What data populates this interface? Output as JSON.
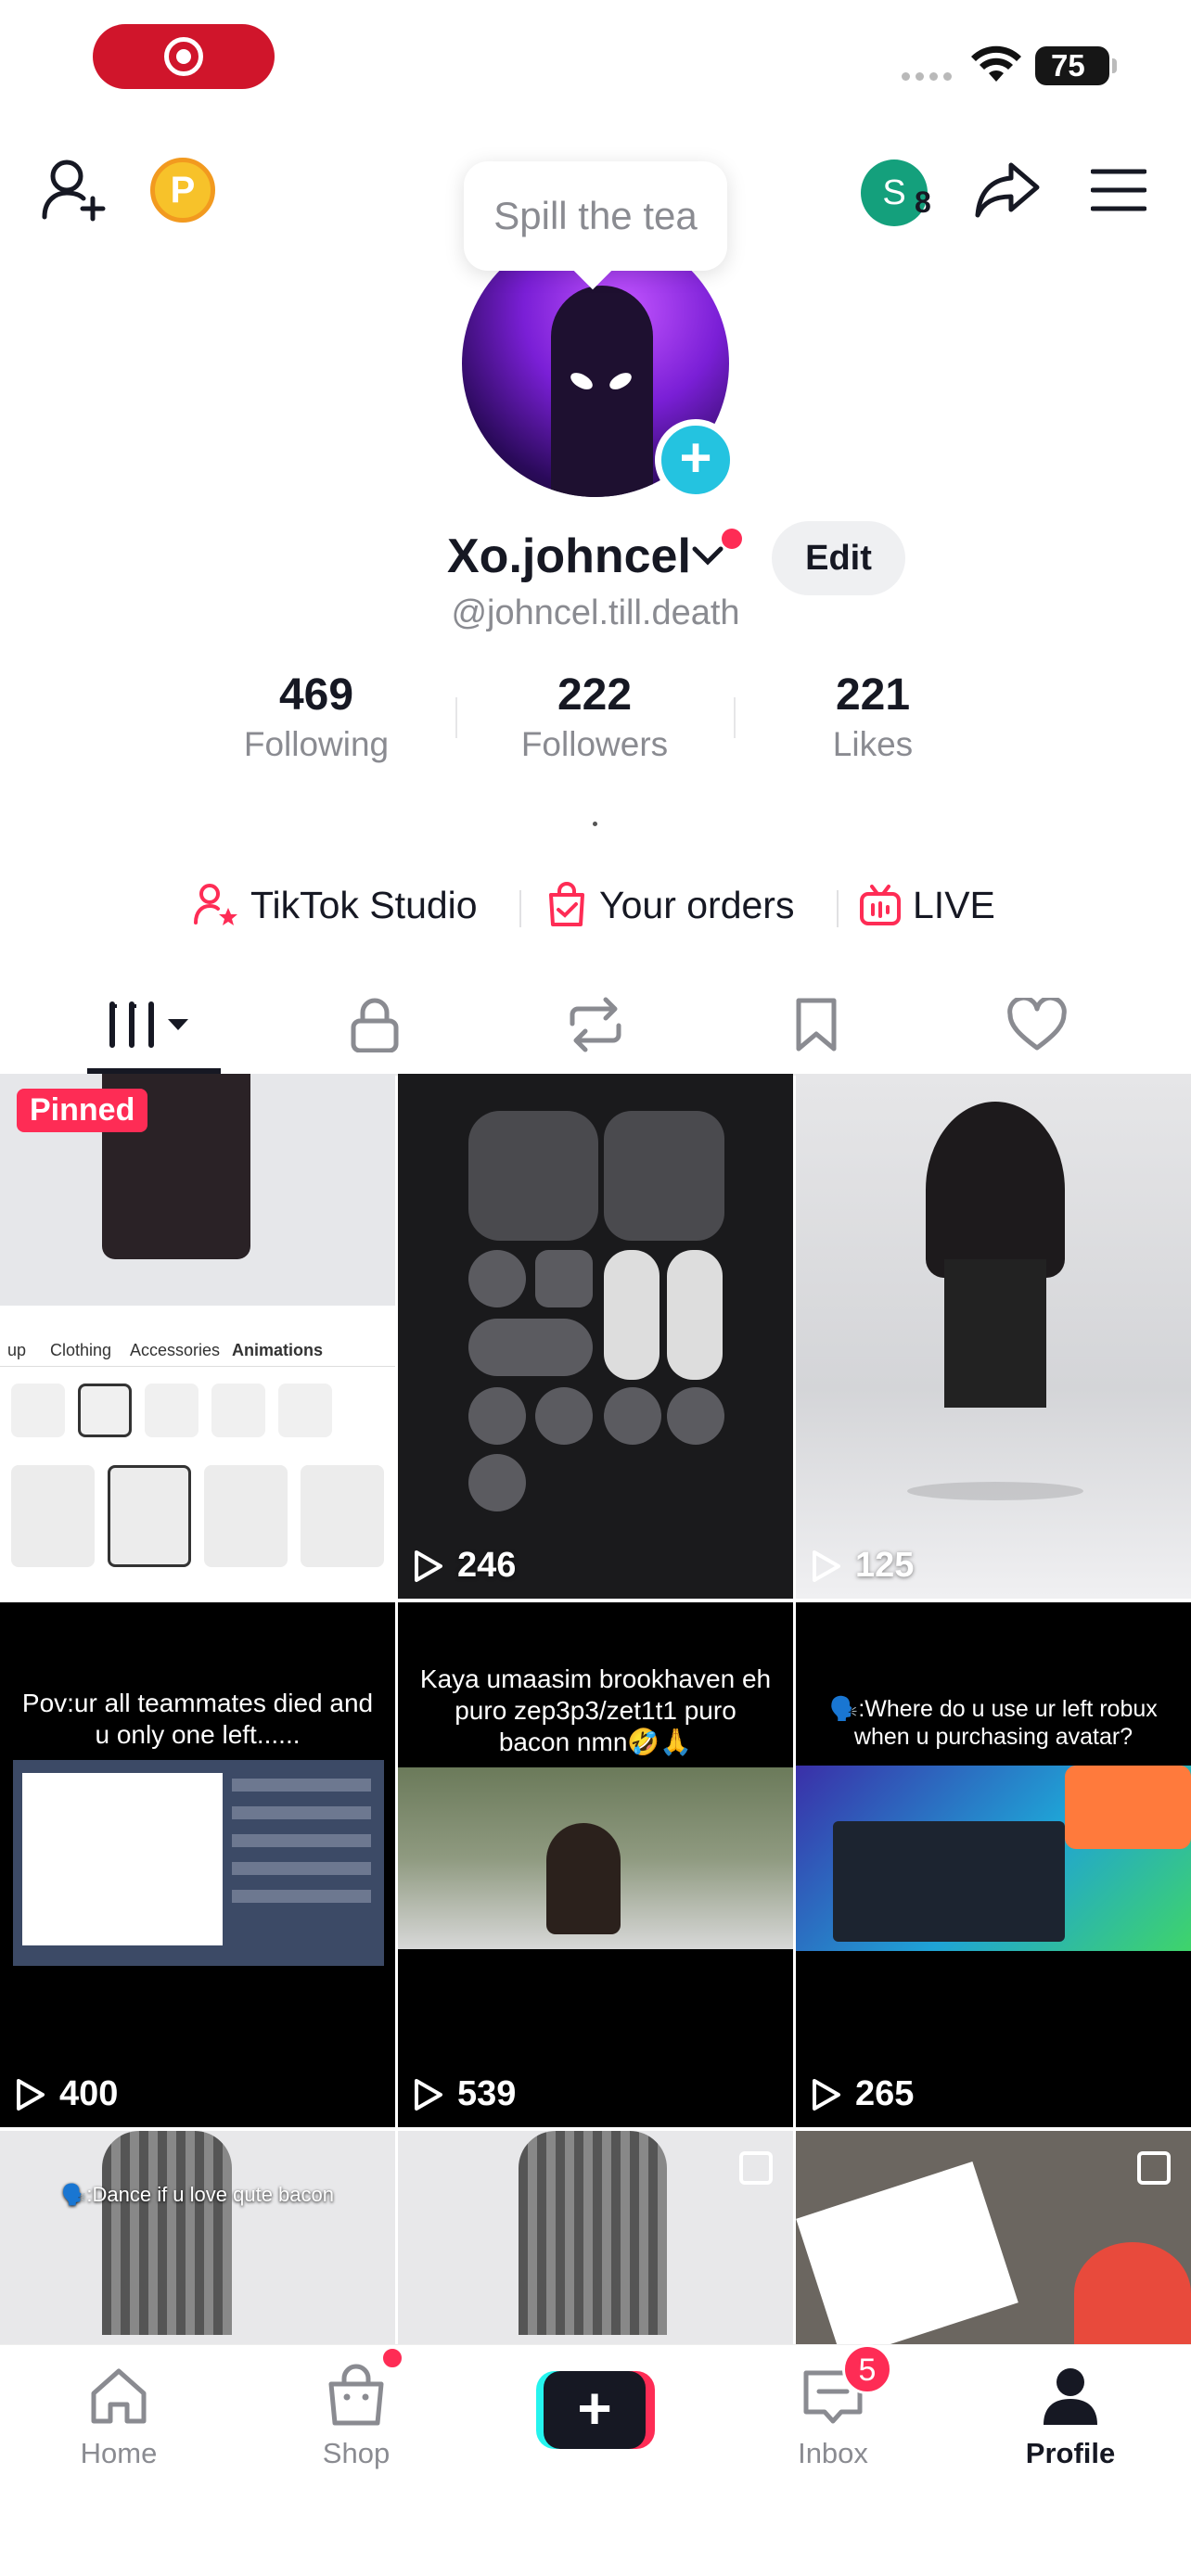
{
  "status_bar": {
    "battery": "75"
  },
  "header": {
    "coin_badge": "P",
    "account_initial": "S",
    "account_count": "8"
  },
  "profile": {
    "tooltip": "Spill the tea",
    "display_name": "Xo.johncel",
    "edit_label": "Edit",
    "handle": "@johncel.till.death",
    "stats": [
      {
        "value": "469",
        "label": "Following"
      },
      {
        "value": "222",
        "label": "Followers"
      },
      {
        "value": "221",
        "label": "Likes"
      }
    ],
    "bio": "."
  },
  "links": [
    {
      "label": "TikTok Studio",
      "icon": "person-star-icon"
    },
    {
      "label": "Your orders",
      "icon": "bag-check-icon"
    },
    {
      "label": "LIVE",
      "icon": "tv-live-icon"
    }
  ],
  "tabs": [
    "videos",
    "private",
    "reposts",
    "favorites",
    "liked"
  ],
  "videos": [
    {
      "pinned_label": "Pinned",
      "views": "",
      "caption": ""
    },
    {
      "views": "246",
      "caption": ""
    },
    {
      "views": "125",
      "caption": ""
    },
    {
      "views": "400",
      "caption": "Pov:ur all teammates died and u only one left......"
    },
    {
      "views": "539",
      "caption": "Kaya umaasim brookhaven eh puro zep3p3/zet1t1 puro bacon nmn🤣🙏"
    },
    {
      "views": "265",
      "caption": "🗣️:Where do u use ur left robux when u purchasing avatar?"
    },
    {
      "views": "",
      "caption": "🗣️:Dance if u love qute bacon"
    },
    {
      "views": "",
      "caption": ""
    },
    {
      "views": "",
      "caption": ""
    }
  ],
  "bottom_nav": {
    "items": [
      {
        "label": "Home"
      },
      {
        "label": "Shop"
      },
      {
        "label": "Create"
      },
      {
        "label": "Inbox",
        "badge": "5"
      },
      {
        "label": "Profile"
      }
    ]
  },
  "colors": {
    "accent": "#fe2c55",
    "cyan": "#25f4ee",
    "text": "#161823",
    "muted": "#8a8b91"
  }
}
